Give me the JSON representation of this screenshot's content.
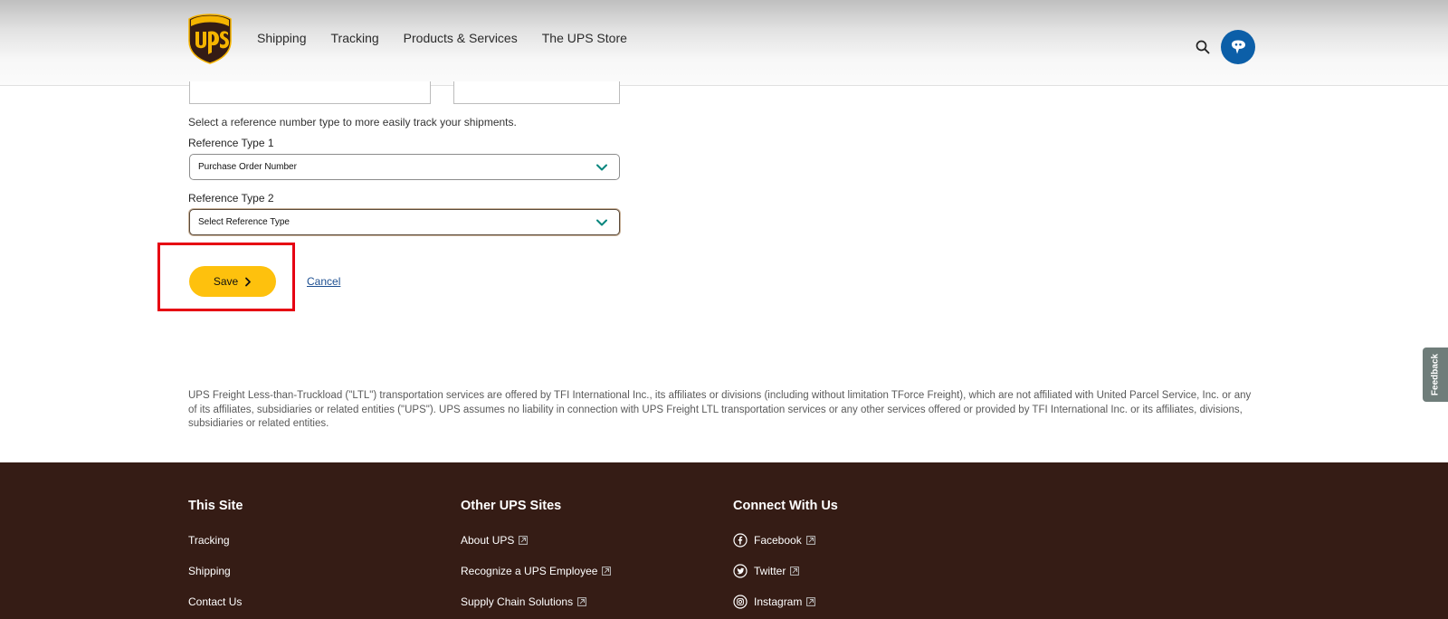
{
  "nav": {
    "items": [
      "Shipping",
      "Tracking",
      "Products & Services",
      "The UPS Store"
    ]
  },
  "form": {
    "helper_text": "Select a reference number type to more easily track your shipments.",
    "ref1_label": "Reference Type 1",
    "ref1_value": "Purchase Order Number",
    "ref2_label": "Reference Type 2",
    "ref2_value": "Select Reference Type",
    "save_label": "Save",
    "cancel_label": "Cancel"
  },
  "disclaimer": "UPS Freight Less-than-Truckload (\"LTL\") transportation services are offered by TFI International Inc., its affiliates or divisions (including without limitation TForce Freight), which are not affiliated with United Parcel Service, Inc. or any of its affiliates, subsidiaries or related entities (\"UPS\"). UPS assumes no liability in connection with UPS Freight LTL transportation services or any other services offered or provided by TFI International Inc. or its affiliates, divisions, subsidiaries or related entities.",
  "feedback_label": "Feedback",
  "footer": {
    "this_site": {
      "title": "This Site",
      "links": [
        "Tracking",
        "Shipping",
        "Contact Us"
      ]
    },
    "other_sites": {
      "title": "Other UPS Sites",
      "links": [
        "About UPS",
        "Recognize a UPS Employee",
        "Supply Chain Solutions"
      ]
    },
    "connect": {
      "title": "Connect With Us",
      "links": [
        "Facebook",
        "Twitter",
        "Instagram"
      ]
    }
  },
  "colors": {
    "ups_brown": "#351c15",
    "ups_gold": "#fec10d",
    "link_blue": "#1d4f91",
    "avatar_blue": "#0c5fa8",
    "highlight_red": "#e60012"
  }
}
